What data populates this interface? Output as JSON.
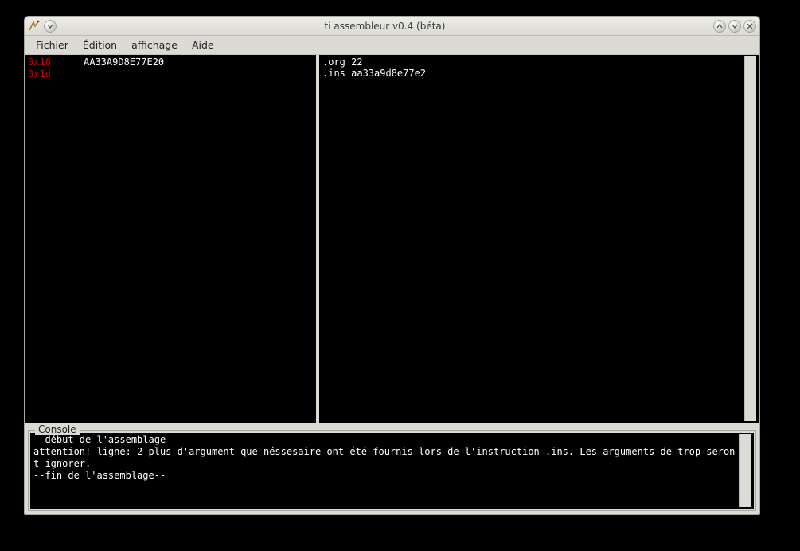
{
  "window": {
    "title": "ti assembleur v0.4 (béta)"
  },
  "menubar": {
    "items": [
      "Fichier",
      "Édition",
      "affichage",
      "Aide"
    ]
  },
  "listing": {
    "lines": [
      {
        "addr": "0x16",
        "data": "AA33A9D8E77E20"
      },
      {
        "addr": "0x1d",
        "data": ""
      }
    ]
  },
  "source": {
    "lines": [
      ".org 22",
      ".ins aa33a9d8e77e2"
    ]
  },
  "console": {
    "label": "Console",
    "text": "--début de l'assemblage--\nattention! ligne: 2 plus d'argument que néssesaire ont été fournis lors de l'instruction .ins. Les arguments de trop seront ignorer.\n--fin de l'assemblage--"
  },
  "icons": {
    "app": "app-icon",
    "menu": "menu-icon",
    "minimize": "minimize-icon",
    "maximize": "maximize-icon",
    "close": "close-icon"
  }
}
